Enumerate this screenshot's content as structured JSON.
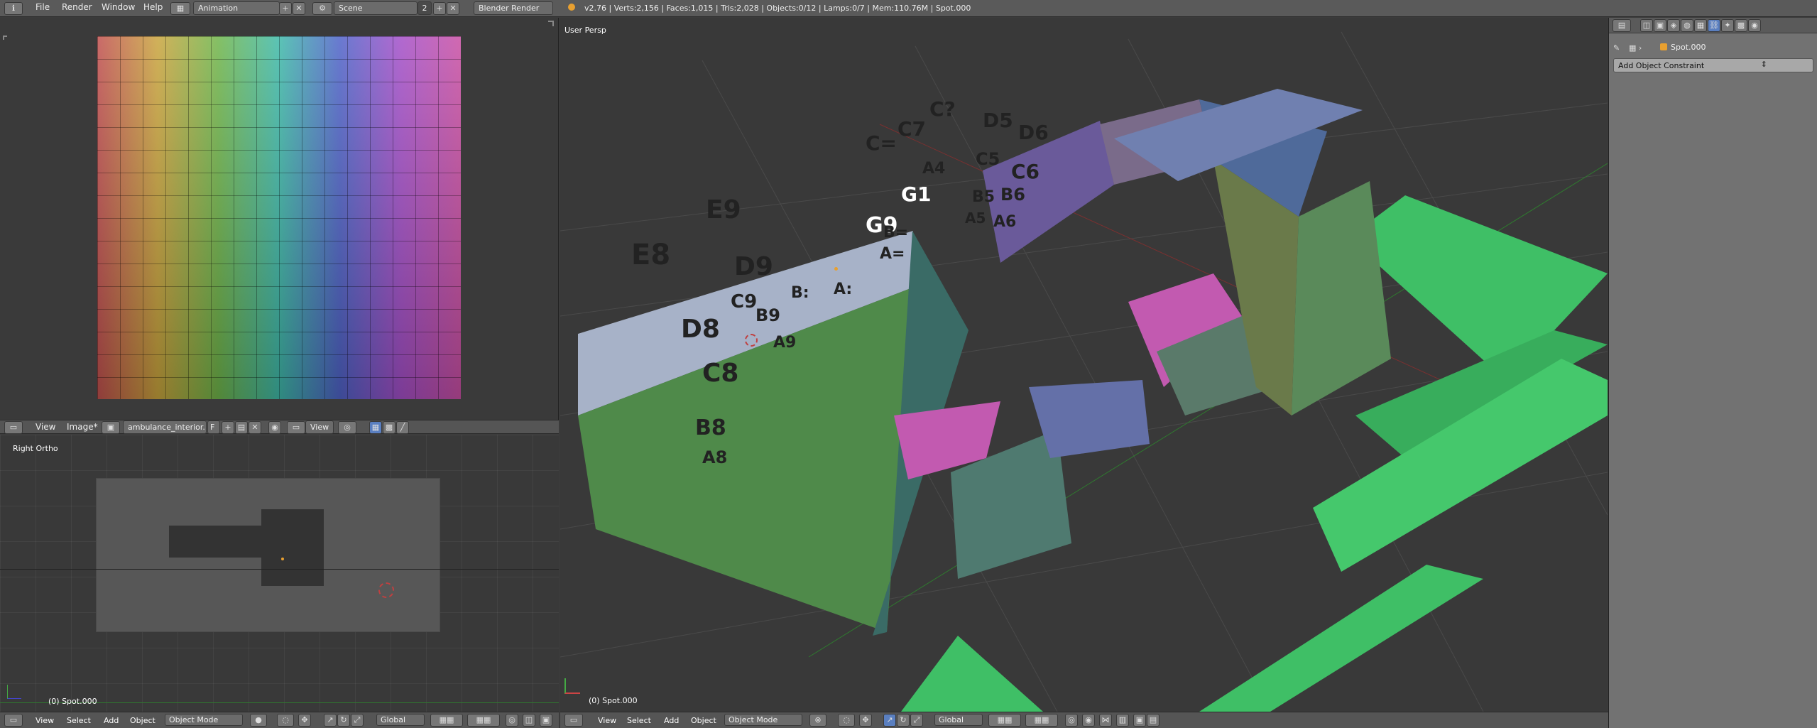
{
  "topbar": {
    "menus": [
      "File",
      "Render",
      "Window",
      "Help"
    ],
    "layout": "Animation",
    "scene": "Scene",
    "scene_users": "2",
    "engine": "Blender Render",
    "stats": "v2.76 | Verts:2,156 | Faces:1,015 | Tris:2,028 | Objects:0/12 | Lamps:0/7 | Mem:110.76M | Spot.000"
  },
  "image_editor": {
    "menus": [
      "View",
      "Image*"
    ],
    "image_name": "ambulance_interior...",
    "fake_user": "F",
    "view_label": "View"
  },
  "left_viewport": {
    "label": "Right Ortho",
    "status": "(0) Spot.000"
  },
  "main_viewport": {
    "label": "User Persp",
    "status": "(0) Spot.000"
  },
  "bottom_left": {
    "menus": [
      "View",
      "Select",
      "Add",
      "Object"
    ],
    "mode": "Object Mode",
    "orientation": "Global"
  },
  "bottom_main": {
    "menus": [
      "View",
      "Select",
      "Add",
      "Object"
    ],
    "mode": "Object Mode",
    "orientation": "Global"
  },
  "properties": {
    "object_name": "Spot.000",
    "add_constraint": "Add Object Constraint"
  },
  "mesh_labels": [
    "E8",
    "D8",
    "C8",
    "B8",
    "A8",
    "D9",
    "C9",
    "B9",
    "A9",
    "B:",
    "A:",
    "C=",
    "C7",
    "C?",
    "A4",
    "D5",
    "D6",
    "C5",
    "C6",
    "B5",
    "B6",
    "A5",
    "A6",
    "G9",
    "G1",
    "A=",
    "B=",
    "E9"
  ],
  "colors": {
    "accent_green": "#3fbf66",
    "mesh_pink": "#c25ab0",
    "mesh_green": "#4f8a4a"
  }
}
